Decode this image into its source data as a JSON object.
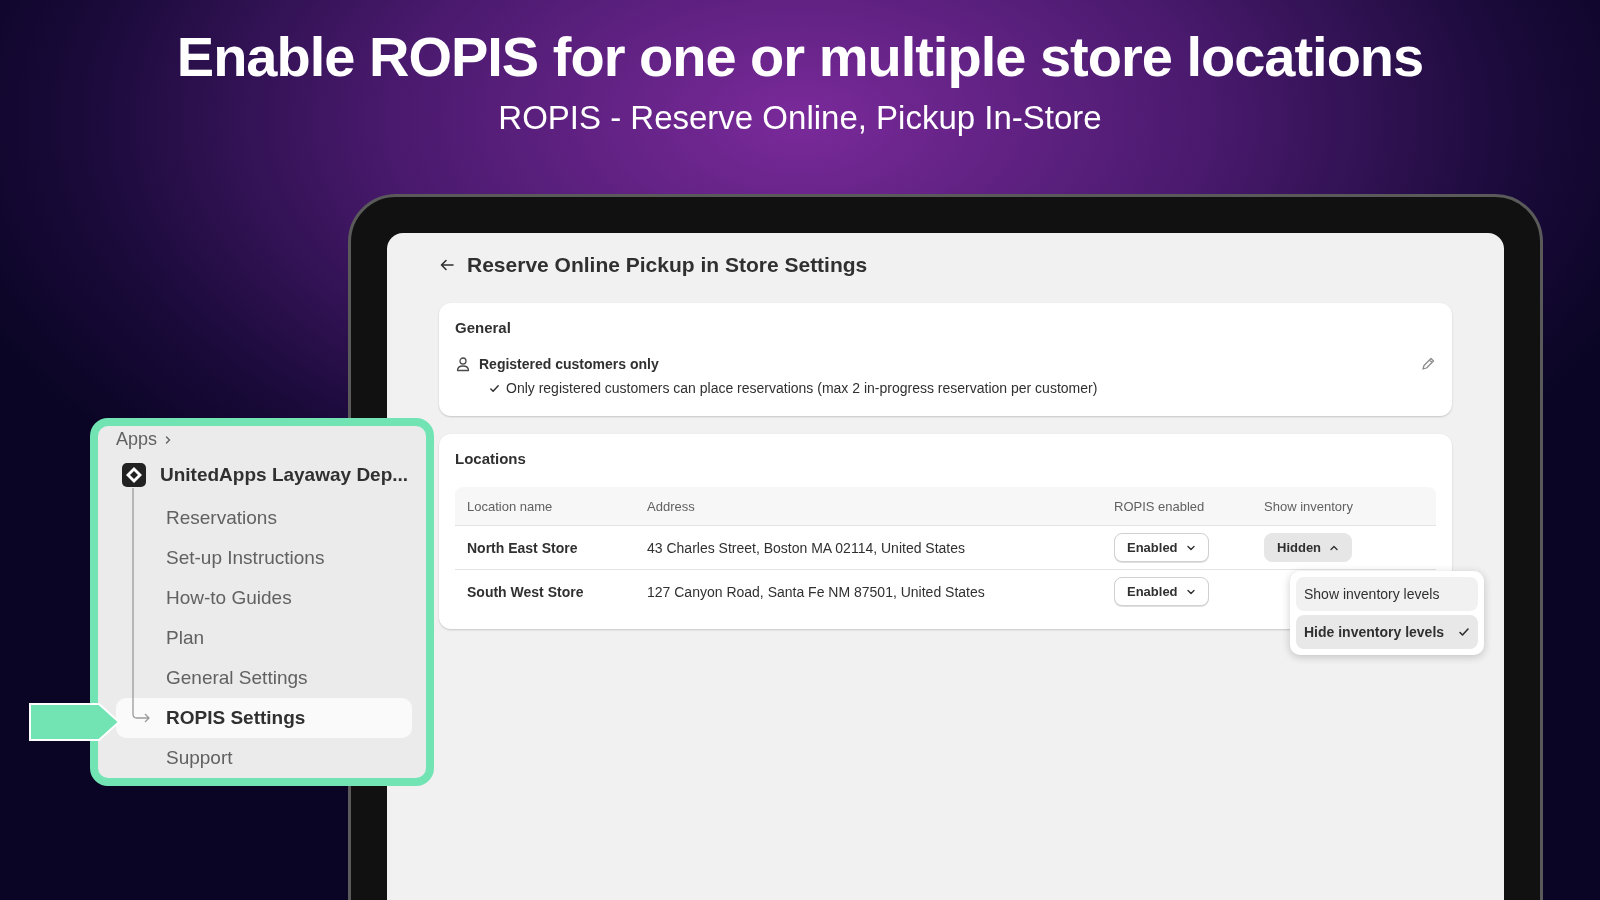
{
  "headline": "Enable ROPIS for one or multiple store locations",
  "subheadline": "ROPIS - Reserve Online, Pickup In-Store",
  "page": {
    "title": "Reserve Online Pickup in Store Settings"
  },
  "general": {
    "heading": "General",
    "setting": "Registered customers only",
    "detail": "Only registered customers can place reservations (max 2 in-progress reservation per customer)"
  },
  "locations": {
    "heading": "Locations",
    "columns": [
      "Location name",
      "Address",
      "ROPIS enabled",
      "Show inventory"
    ],
    "rows": [
      {
        "name": "North East Store",
        "address": "43 Charles Street, Boston MA 02114, United States",
        "ropis": "Enabled",
        "inventory": "Hidden",
        "expanded": true
      },
      {
        "name": "South West Store",
        "address": "127 Canyon Road, Santa Fe NM 87501, United States",
        "ropis": "Enabled"
      }
    ]
  },
  "dropdown": {
    "options": [
      {
        "label": "Show inventory levels",
        "selected": false
      },
      {
        "label": "Hide inventory levels",
        "selected": true
      }
    ]
  },
  "nav": {
    "breadcrumb": "Apps",
    "app": "UnitedApps Layaway Dep...",
    "items": [
      {
        "label": "Reservations",
        "selected": false
      },
      {
        "label": "Set-up Instructions",
        "selected": false
      },
      {
        "label": "How-to Guides",
        "selected": false
      },
      {
        "label": "Plan",
        "selected": false
      },
      {
        "label": "General Settings",
        "selected": false
      },
      {
        "label": "ROPIS Settings",
        "selected": true
      },
      {
        "label": "Support",
        "selected": false
      }
    ]
  }
}
